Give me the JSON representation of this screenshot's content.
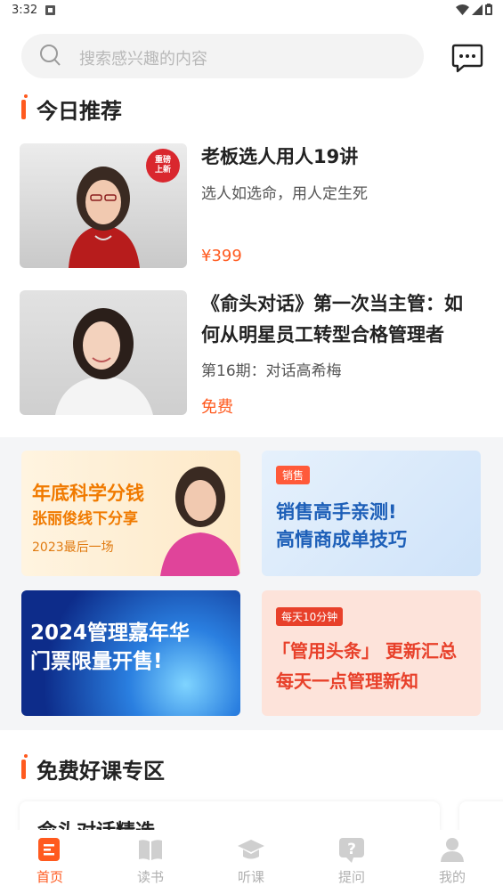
{
  "status_bar": {
    "time": "3:32"
  },
  "search": {
    "placeholder": "搜索感兴趣的内容"
  },
  "today": {
    "title": "今日推荐",
    "courses": [
      {
        "title": "老板选人用人19讲",
        "subtitle": "选人如选命，用人定生死",
        "price": "¥399",
        "badge_line1": "重磅",
        "badge_line2": "上新"
      },
      {
        "title_line1": "《俞头对话》第一次当主管：如",
        "title_line2": "何从明星员工转型合格管理者",
        "subtitle": "第16期：对话高希梅",
        "price": "免费"
      }
    ]
  },
  "banners": [
    {
      "line1": "年底科学分钱",
      "line2": "张丽俊线下分享",
      "line3": "2023最后一场"
    },
    {
      "tag": "销售",
      "line1": "销售高手亲测!",
      "line2": "高情商成单技巧"
    },
    {
      "line1": "2024管理嘉年华",
      "line2": "门票限量开售!"
    },
    {
      "tag": "每天10分钟",
      "line1": "「管用头条」 更新汇总",
      "line2": "每天一点管理新知"
    }
  ],
  "free": {
    "title": "免费好课专区",
    "card1_partial": "俞头对话精选"
  },
  "tabs": [
    {
      "label": "首页"
    },
    {
      "label": "读书"
    },
    {
      "label": "听课"
    },
    {
      "label": "提问"
    },
    {
      "label": "我的"
    }
  ],
  "colors": {
    "accent": "#ff5a1f"
  }
}
